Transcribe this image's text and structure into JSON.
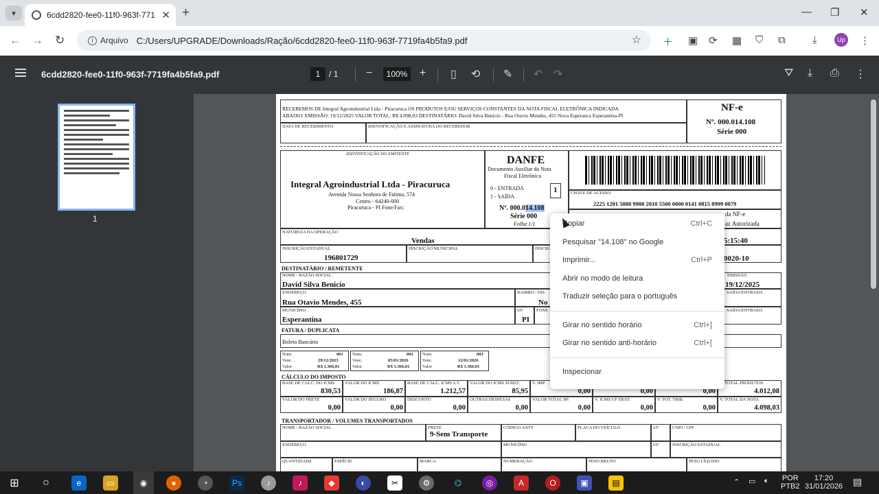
{
  "browser": {
    "tab_title": "6cdd2820-fee0-11f0-963f-7719",
    "chip_label": "Arquivo",
    "url": "C:/Users/UPGRADE/Downloads/Ração/6cdd2820-fee0-11f0-963f-7719fa4b5fa9.pdf",
    "profile_initials": "Up"
  },
  "pdf_viewer": {
    "file_name": "6cdd2820-fee0-11f0-963f-7719fa4b5fa9.pdf",
    "current_page": "1",
    "page_separator": "/",
    "total_pages": "1",
    "zoom": "100%",
    "thumbnail_label": "1"
  },
  "danfe": {
    "receipt_text_1": "RECEBEMOS DE Integral Agroindustrial Ltda - Piracuruca OS PRODUTOS E/OU SERVIÇOS CONSTANTES DA NOTA FISCAL ELETRÔNICA INDICADA",
    "receipt_text_2": "ABAIXO. EMISSÃO: 19/12/2025 VALOR TOTAL: R$ 4.098,03 DESTINATÁRIO: David Silva Benicio - Rua Otavio Mendes, 455 Nova Esperanca Esperantina-PI",
    "data_recebimento_label": "DATA DE RECEBIMENTO",
    "identificacao_label": "IDENTIFICAÇÃO E ASSINATURA DO RECEBEDOR",
    "nfe_title": "NF-e",
    "nfe_number": "Nº. 000.014.108",
    "nfe_serie": "Série 000",
    "emitente_label": "IDENTIFICAÇÃO DO EMITENTE",
    "emitente_name": "Integral Agroindustrial Ltda - Piracuruca",
    "emitente_addr1": "Avenida Nossa Senhora de Fatima, 574",
    "emitente_addr2": "Centro - 64240-000",
    "emitente_addr3": "Piracuruca - PI Fone/Fax:",
    "danfe_title": "DANFE",
    "danfe_sub1": "Documento Auxiliar da Nota",
    "danfe_sub2": "Fiscal Eletrônica",
    "entrada": "0 - ENTRADA",
    "saida": "1 - SAÍDA",
    "tipo": "1",
    "num_prefix": "Nº. 000.0",
    "num_highlight": "14.108",
    "serie": "Série 000",
    "folha": "Folha 1/1",
    "chave_label": "CHAVE DE ACESSO",
    "chave": "2225 1201 5880 9900 2010 5500 0000 0141 0815 8999 0079",
    "consulta_partial": "da NF-e",
    "autorizada_partial": "az Autorizada",
    "protocolo_partial": "5:15:40",
    "natureza_label": "NATUREZA DA OPERAÇÃO",
    "natureza": "Vendas",
    "ie_label": "INSCRIÇÃO ESTADUAL",
    "ie": "196801729",
    "im_label": "INSCRIÇÃO MUNICIPAL",
    "ie_st_label": "INSCRI",
    "cnpj_partial": "0020-10",
    "dest_section": "DESTINATÁRIO / REMETENTE",
    "nome_label": "NOME / RAZÃO SOCIAL",
    "nome": "David Silva Benicio",
    "emissao_label": "EMISSÃO",
    "emissao": "19/12/2025",
    "endereco_label": "ENDEREÇO",
    "endereco": "Rua Otavio Mendes, 455",
    "bairro_label": "BAIRRO / DIS",
    "bairro": "No",
    "saida_entrada_label": "SAÍDA/ENTRADA",
    "municipio_label": "MUNICÍPIO",
    "municipio": "Esperantina",
    "uf_label": "UF",
    "uf": "PI",
    "fone_label": "FONE",
    "saida_entrada_label2": "SAÍDA/ENTRADA",
    "fatura_section": "FATURA / DUPLICATA",
    "forma": "Boleto Bancário",
    "dups": [
      {
        "num_label": "Num.",
        "num": "001",
        "venc_label": "Venc.",
        "venc": "29/12/2025",
        "valor_label": "Valor",
        "valor": "R$ 1.366,01"
      },
      {
        "num_label": "Num.",
        "num": "002",
        "venc_label": "Venc.",
        "venc": "05/01/2026",
        "valor_label": "Valor",
        "valor": "R$ 1.366,01"
      },
      {
        "num_label": "Num.",
        "num": "003",
        "venc_label": "Venc.",
        "venc": "12/01/2026",
        "valor_label": "Valor",
        "valor": "R$ 1.366,01"
      }
    ],
    "imposto_section": "CÁLCULO DO IMPOSTO",
    "imp_row1": [
      {
        "label": "BASE DE CALC. DO ICMS",
        "value": "830,53"
      },
      {
        "label": "VALOR DO ICMS",
        "value": "186,87"
      },
      {
        "label": "BASE DE CALC. ICMS S.T.",
        "value": "1.212,57"
      },
      {
        "label": "VALOR DO ICMS SUBST.",
        "value": "85,95"
      },
      {
        "label": "V. IMP",
        "value": "0,00"
      },
      {
        "label": "",
        "value": "0,00"
      },
      {
        "label": "",
        "value": "0,00"
      },
      {
        "label": "V. TOTAL PRODUTOS",
        "value": "4.012,08"
      }
    ],
    "imp_row2": [
      {
        "label": "VALOR DO FRETE",
        "value": "0,00"
      },
      {
        "label": "VALOR DO SEGURO",
        "value": "0,00"
      },
      {
        "label": "DESCONTO",
        "value": "0,00"
      },
      {
        "label": "OUTRAS DESPESAS",
        "value": "0,00"
      },
      {
        "label": "VALOR TOTAL IPI",
        "value": "0,00"
      },
      {
        "label": "V. ICMS UF DEST.",
        "value": "0,00"
      },
      {
        "label": "V. TOT. TRIB.",
        "value": "0,00"
      },
      {
        "label": "V. TOTAL DA NOTA",
        "value": "4.098,03"
      }
    ],
    "transp_section": "TRANSPORTADOR / VOLUMES TRANSPORTADOS",
    "transp_nome_label": "NOME / RAZÃO SOCIAL",
    "frete_label": "FRETE",
    "frete": "9-Sem Transporte",
    "antt_label": "CÓDIGO ANTT",
    "placa_label": "PLACA DO VEÍCULO",
    "uf2_label": "UF",
    "cnpj_label": "CNPJ / CPF",
    "end2_label": "ENDEREÇO",
    "mun2_label": "MUNICÍPIO",
    "uf3_label": "UF",
    "ie2_label": "INSCRIÇÃO ESTADUAL",
    "qtd_label": "QUANTIDADE",
    "especie_label": "ESPÉCIE",
    "marca_label": "MARCA",
    "numeracao_label": "NUMERAÇÃO",
    "peso_bruto_label": "PESO BRUTO",
    "peso_liq_label": "PESO LÍQUIDO"
  },
  "context_menu": {
    "items": [
      {
        "label": "Copiar",
        "shortcut": "Ctrl+C"
      },
      {
        "label": "Pesquisar \"14.108\" no Google",
        "shortcut": ""
      },
      {
        "label": "Imprimir...",
        "shortcut": "Ctrl+P"
      },
      {
        "label": "Abrir no modo de leitura",
        "shortcut": ""
      },
      {
        "label": "Traduzir seleção para o português",
        "shortcut": ""
      },
      {
        "label": "Girar no sentido horário",
        "shortcut": "Ctrl+]"
      },
      {
        "label": "Girar no sentido anti-horário",
        "shortcut": "Ctrl+["
      },
      {
        "label": "Inspecionar",
        "shortcut": ""
      }
    ]
  },
  "taskbar": {
    "lang1": "POR",
    "lang2": "PTB2",
    "time": "17:20",
    "date": "31/01/2026"
  }
}
